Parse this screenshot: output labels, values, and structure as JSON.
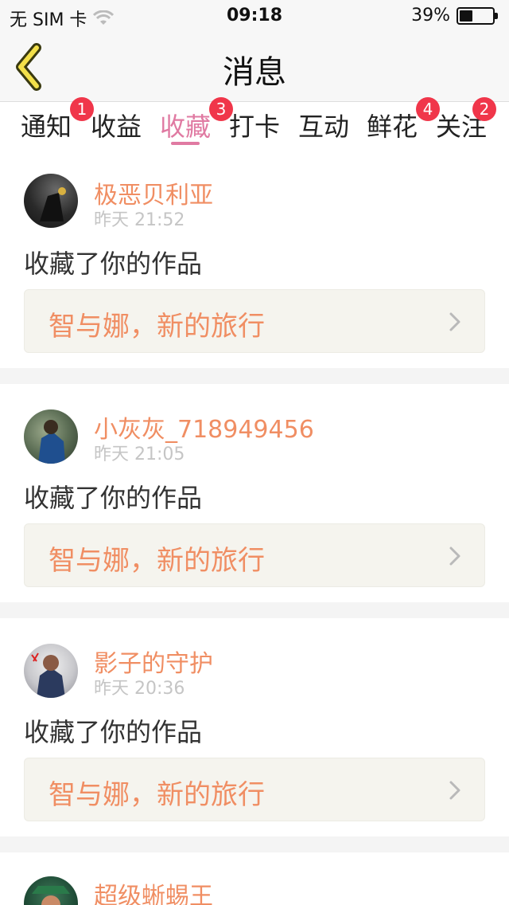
{
  "status_bar": {
    "carrier": "无 SIM 卡",
    "time": "09:18",
    "battery_percent": "39%",
    "battery_level": 0.39
  },
  "nav": {
    "title": "消息",
    "back_icon": "chevron-left-icon"
  },
  "tabs": [
    {
      "label": "通知",
      "badge": "1",
      "active": false
    },
    {
      "label": "收益",
      "badge": "",
      "active": false
    },
    {
      "label": "收藏",
      "badge": "3",
      "active": true
    },
    {
      "label": "打卡",
      "badge": "",
      "active": false
    },
    {
      "label": "互动",
      "badge": "",
      "active": false
    },
    {
      "label": "鲜花",
      "badge": "4",
      "active": false
    },
    {
      "label": "关注",
      "badge": "2",
      "active": false
    }
  ],
  "colors": {
    "accent": "#e07aa2",
    "name": "#f08e63",
    "badge": "#f0364a",
    "box": "#f5f4ee"
  },
  "feed": [
    {
      "name": "极恶贝利亚",
      "time": "昨天 21:52",
      "action": "收藏了你的作品",
      "work": "智与娜，新的旅行"
    },
    {
      "name": "小灰灰_718949456",
      "time": "昨天 21:05",
      "action": "收藏了你的作品",
      "work": "智与娜，新的旅行"
    },
    {
      "name": "影子的守护",
      "time": "昨天 20:36",
      "action": "收藏了你的作品",
      "work": "智与娜，新的旅行"
    },
    {
      "name": "超级蜥蜴王",
      "time": "",
      "action": "",
      "work": ""
    }
  ]
}
